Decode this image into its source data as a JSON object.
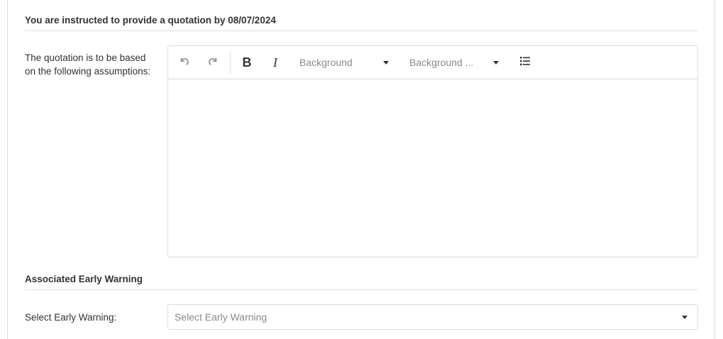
{
  "quotation_section": {
    "title": "You are instructed to provide a quotation by 08/07/2024",
    "assumptions_label": "The quotation is to be based on the following assumptions:",
    "editor": {
      "toolbar": {
        "undo_icon": "undo-icon",
        "redo_icon": "redo-icon",
        "bold_label": "B",
        "italic_label": "I",
        "background_dropdown_label": "Background",
        "background_color_dropdown_label": "Background ...",
        "list_icon": "bulleted-list-icon"
      },
      "content": ""
    }
  },
  "early_warning_section": {
    "title": "Associated Early Warning",
    "select_label": "Select Early Warning:",
    "select_placeholder": "Select Early Warning"
  }
}
